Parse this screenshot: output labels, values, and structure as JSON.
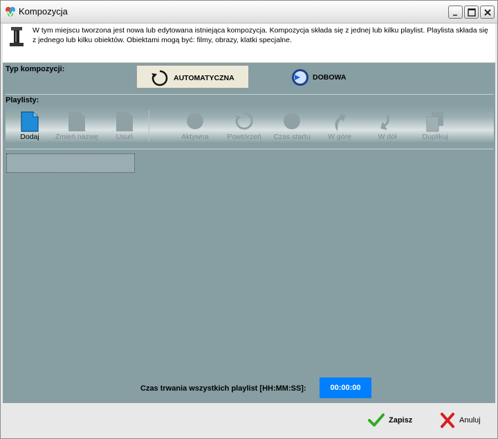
{
  "window": {
    "title": "Kompozycja",
    "icon": "app-logo-icon",
    "controls": [
      "minimize-icon",
      "maximize-icon",
      "close-icon"
    ]
  },
  "info": {
    "icon": "pipe-icon",
    "text": "W tym miejscu tworzona jest nowa lub edytowana istniejąca kompozycja. Kompozycja składa się z jednej lub kilku playlist. Playlista składa się z jednego lub kilku obiektów. Obiektami mogą być: filmy, obrazy, klatki specjalne."
  },
  "composition_type": {
    "label": "Typ kompozycji:",
    "options": [
      {
        "label": "AUTOMATYCZNA",
        "icon": "rotate-icon",
        "selected": true
      },
      {
        "label": "DOBOWA",
        "icon": "clock-icon",
        "selected": false
      }
    ]
  },
  "playlists": {
    "label": "Playlisty:",
    "tools": [
      {
        "label": "Dodaj",
        "icon": "new-document-icon",
        "enabled": true
      },
      {
        "label": "Zmień nazwę",
        "icon": "document-icon",
        "enabled": false
      },
      {
        "label": "Usuń",
        "icon": "document-icon",
        "enabled": false
      },
      {
        "label": "Aktywna",
        "icon": "circle-icon",
        "enabled": false
      },
      {
        "label": "Powtórzeń",
        "icon": "repeat-icon",
        "enabled": false
      },
      {
        "label": "Czas startu",
        "icon": "circle-icon",
        "enabled": false
      },
      {
        "label": "W górę",
        "icon": "arrow-up-icon",
        "enabled": false
      },
      {
        "label": "W dół",
        "icon": "arrow-down-icon",
        "enabled": false
      },
      {
        "label": "Duplikuj",
        "icon": "duplicate-icon",
        "enabled": false
      }
    ]
  },
  "duration": {
    "label": "Czas trwania wszystkich playlist [HH:MM:SS]:",
    "value": "00:00:00"
  },
  "footer": {
    "save_label": "Zapisz",
    "cancel_label": "Anuluj"
  },
  "colors": {
    "panel": "#879ea2",
    "duration_bg": "#0080ff",
    "save_check": "#2eaa1f",
    "cancel_x": "#d81e1e"
  }
}
